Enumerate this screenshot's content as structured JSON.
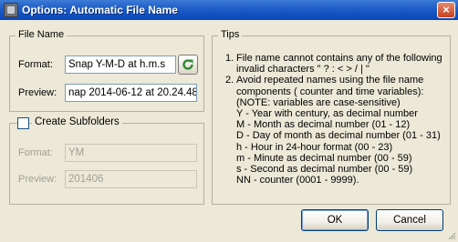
{
  "window": {
    "title": "Options: Automatic File Name",
    "close_label": "×"
  },
  "file_name": {
    "legend": "File Name",
    "format_label": "Format:",
    "format_value": "Snap Y-M-D at h.m.s",
    "preview_label": "Preview:",
    "preview_value": "nap 2014-06-12 at 20.24.48"
  },
  "subfolders": {
    "legend": "Create Subfolders",
    "checked": false,
    "format_label": "Format:",
    "format_value": "YM",
    "preview_label": "Preview:",
    "preview_value": "201406"
  },
  "tips": {
    "legend": "Tips",
    "items": [
      {
        "num": "1.",
        "lines": [
          "File name cannot contains any of the following",
          "invalid characters  \" ? : < > / |  \""
        ]
      },
      {
        "num": "2.",
        "lines": [
          "Avoid repeated names using the file name",
          "components ( counter and time variables):",
          "(NOTE: variables are case-sensitive)",
          "Y - Year with century, as decimal number",
          "M - Month as decimal number (01 - 12)",
          "D - Day of month as decimal number (01 - 31)",
          "h - Hour in 24-hour format (00 - 23)",
          "m - Minute as decimal number (00 - 59)",
          "s - Second as decimal number (00 - 59)",
          "NN - counter (0001 - 9999)."
        ]
      }
    ]
  },
  "buttons": {
    "ok": "OK",
    "cancel": "Cancel"
  },
  "icons": {
    "app": "app-icon",
    "refresh": "refresh-icon",
    "close": "close-icon",
    "grip": "resize-grip-icon"
  },
  "colors": {
    "titlebar": "#0a46b8",
    "refresh_arrow": "#2e8b2e",
    "dialog_bg": "#ece9d8"
  }
}
